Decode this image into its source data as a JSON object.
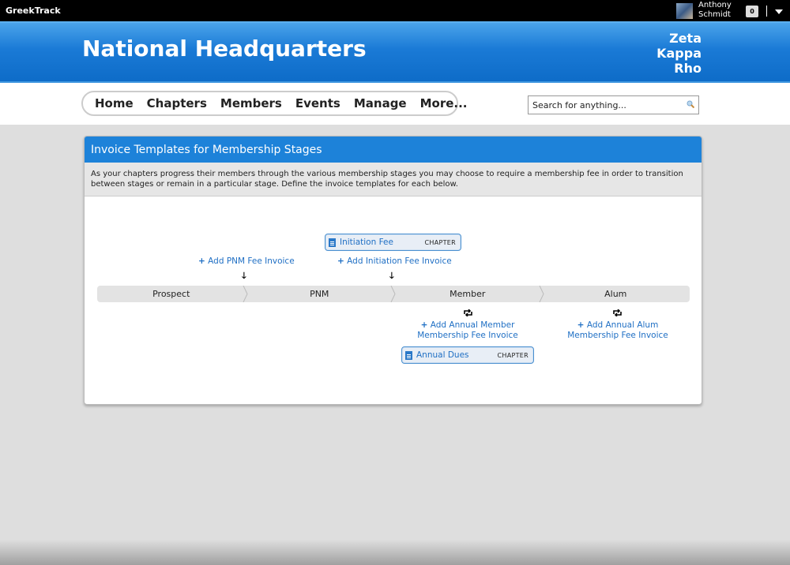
{
  "topbar": {
    "brand": "GreekTrack",
    "user": {
      "first": "Anthony",
      "last": "Schmidt"
    },
    "notifications": "0",
    "menu_icon": "caret-down-icon"
  },
  "header": {
    "title": "National Headquarters",
    "org_lines": [
      "Zeta",
      "Kappa",
      "Rho"
    ]
  },
  "nav": {
    "items": [
      {
        "label": "Home"
      },
      {
        "label": "Chapters"
      },
      {
        "label": "Members"
      },
      {
        "label": "Events"
      },
      {
        "label": "Manage"
      },
      {
        "label": "More..."
      }
    ]
  },
  "search": {
    "placeholder": "Search for anything...",
    "value": ""
  },
  "card": {
    "title": "Invoice Templates for Membership Stages",
    "description": "As your chapters progress their members through the various membership stages you may choose to require a membership fee in order to transition between stages or remain in a particular stage. Define the invoice templates for each below.",
    "stages": [
      "Prospect",
      "PNM",
      "Member",
      "Alum"
    ],
    "transitions": [
      {
        "link": "Add PNM Fee Invoice",
        "templates": []
      },
      {
        "link": "Add Initiation Fee Invoice",
        "templates": [
          {
            "name": "Initiation Fee",
            "scope": "CHAPTER"
          }
        ]
      }
    ],
    "recurring": [
      {
        "link_line1": "Add Annual Member",
        "link_line2": "Membership Fee Invoice",
        "templates": [
          {
            "name": "Annual Dues",
            "scope": "CHAPTER"
          }
        ]
      },
      {
        "link_line1": "Add Annual Alum",
        "link_line2": "Membership Fee Invoice",
        "templates": []
      }
    ]
  }
}
